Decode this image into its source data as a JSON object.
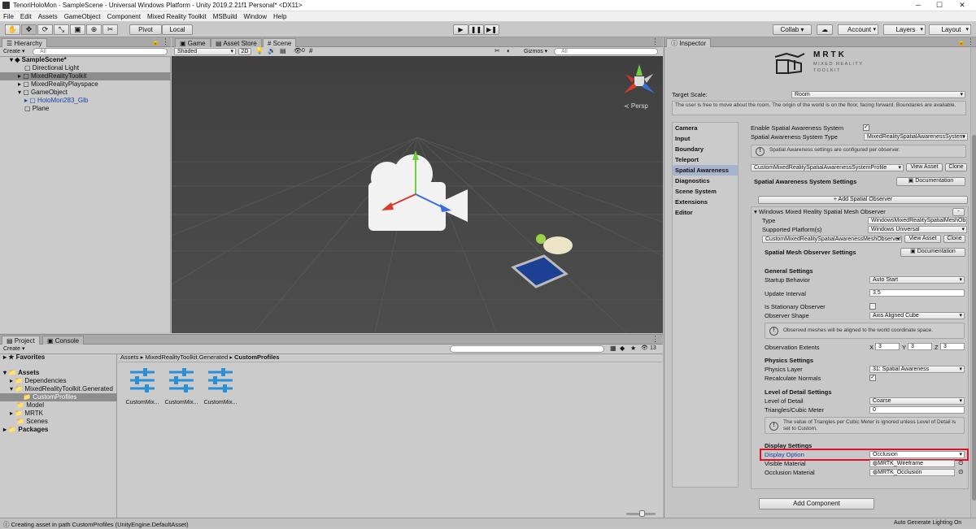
{
  "titlebar": {
    "title": "TenoriHoloMon - SampleScene - Universal Windows Platform - Unity 2019.2.21f1 Personal* <DX11>",
    "minimize": "─",
    "maximize": "☐",
    "close": "✕"
  },
  "menu": [
    "File",
    "Edit",
    "Assets",
    "GameObject",
    "Component",
    "Mixed Reality Toolkit",
    "MSBuild",
    "Window",
    "Help"
  ],
  "toolbar": {
    "pivot": "Pivot",
    "local": "Local",
    "collab": "Collab ▾",
    "account": "Account",
    "layers": "Layers",
    "layout": "Layout"
  },
  "hierarchy": {
    "tab": "Hierarchy",
    "create": "Create ▾",
    "search_placeholder": "All",
    "items": [
      {
        "label": "SampleScene*"
      },
      {
        "label": "Directional Light"
      },
      {
        "label": "MixedRealityToolkit"
      },
      {
        "label": "MixedRealityPlayspace"
      },
      {
        "label": "GameObject"
      },
      {
        "label": "HoloMon283_Glb"
      },
      {
        "label": "Plane"
      }
    ]
  },
  "scene": {
    "tabs": [
      "Game",
      "Asset Store",
      "Scene"
    ],
    "shading": "Shaded",
    "mode_2d": "2D",
    "fx_count": "0",
    "gizmos": "Gizmos ▾",
    "search_placeholder": "All",
    "persp": "≺ Persp"
  },
  "project": {
    "tabs": [
      "Project",
      "Console"
    ],
    "create": "Create ▾",
    "count": "13",
    "tree": [
      {
        "label": "Favorites"
      },
      {
        "label": "Assets"
      },
      {
        "label": "Dependencies"
      },
      {
        "label": "MixedRealityToolkit.Generated"
      },
      {
        "label": "CustomProfiles"
      },
      {
        "label": "Model"
      },
      {
        "label": "MRTK"
      },
      {
        "label": "Scenes"
      },
      {
        "label": "Packages"
      }
    ],
    "breadcrumb": [
      "Assets",
      "MixedRealityToolkit.Generated",
      "CustomProfiles"
    ],
    "assets": [
      {
        "label": "CustomMix..."
      },
      {
        "label": "CustomMix..."
      },
      {
        "label": "CustomMix..."
      }
    ]
  },
  "status": {
    "message": "Creating asset in path CustomProfiles (UnityEngine.DefaultAsset)",
    "right": "Auto Generate Lighting On"
  },
  "inspector": {
    "tab": "Inspector",
    "logo": {
      "title": "MRTK",
      "subtitle1": "MIXED REALITY",
      "subtitle2": "TOOLKIT"
    },
    "target_scale_label": "Target Scale:",
    "target_scale_value": "Room",
    "target_scale_help": "The user is free to move about the room. The origin of the world is on the floor, facing forward. Boundaries are available.",
    "categories": [
      "Camera",
      "Input",
      "Boundary",
      "Teleport",
      "Spatial Awareness",
      "Diagnostics",
      "Scene System",
      "Extensions",
      "Editor"
    ],
    "enable_label": "Enable Spatial Awareness System",
    "system_type_label": "Spatial Awareness System Type",
    "system_type_value": "MixedRealitySpatialAwarenessSystem",
    "per_observer_help": "Spatial Awareness settings are configured per observer.",
    "profile_value": "CustomMixedRealitySpatialAwarenessSystemProfile",
    "view_asset": "View Asset",
    "clone": "Clone",
    "system_settings_title": "Spatial Awareness System Settings",
    "documentation": "Documentation",
    "add_observer": "+ Add Spatial Observer",
    "observer_title": "Windows Mixed Reality Spatial Mesh Observer",
    "remove": "-",
    "type_label": "Type",
    "type_value": "WindowsMixedRealitySpatialMeshObserver",
    "platforms_label": "Supported Platform(s)",
    "platforms_value": "Windows Universal",
    "mesh_profile_value": "CustomMixedRealitySpatialAwarenessMeshObserverProfile",
    "mesh_settings_title": "Spatial Mesh Observer Settings",
    "general_title": "General Settings",
    "startup_label": "Startup Behavior",
    "startup_value": "Auto Start",
    "update_label": "Update Interval",
    "update_value": "3.5",
    "stationary_label": "Is Stationary Observer",
    "shape_label": "Observer Shape",
    "shape_value": "Axis Aligned Cube",
    "shape_help": "Observed meshes will be aligned to the world coordinate space.",
    "extents_label": "Observation Extents",
    "extents": [
      {
        "axis": "X",
        "value": "3"
      },
      {
        "axis": "Y",
        "value": "3"
      },
      {
        "axis": "Z",
        "value": "3"
      }
    ],
    "physics_title": "Physics Settings",
    "physics_layer_label": "Physics Layer",
    "physics_layer_value": "31: Spatial Awareness",
    "recalc_label": "Recalculate Normals",
    "lod_title": "Level of Detail Settings",
    "lod_label": "Level of Detail",
    "lod_value": "Coarse",
    "triangles_label": "Triangles/Cubic Meter",
    "triangles_value": "0",
    "lod_help": "The value of Triangles per Cubic Meter is ignored unless Level of Detail is set to Custom.",
    "display_title": "Display Settings",
    "display_option_label": "Display Option",
    "display_option_value": "Occlusion",
    "visible_material_label": "Visible Material",
    "visible_material_value": "MRTK_Wireframe",
    "occlusion_material_label": "Occlusion Material",
    "occlusion_material_value": "MRTK_Occlusion",
    "add_component": "Add Component"
  },
  "colors": {
    "highlight": "#e0102a",
    "scene_bg": "#474747",
    "selected_category": "#a6b4cf"
  }
}
